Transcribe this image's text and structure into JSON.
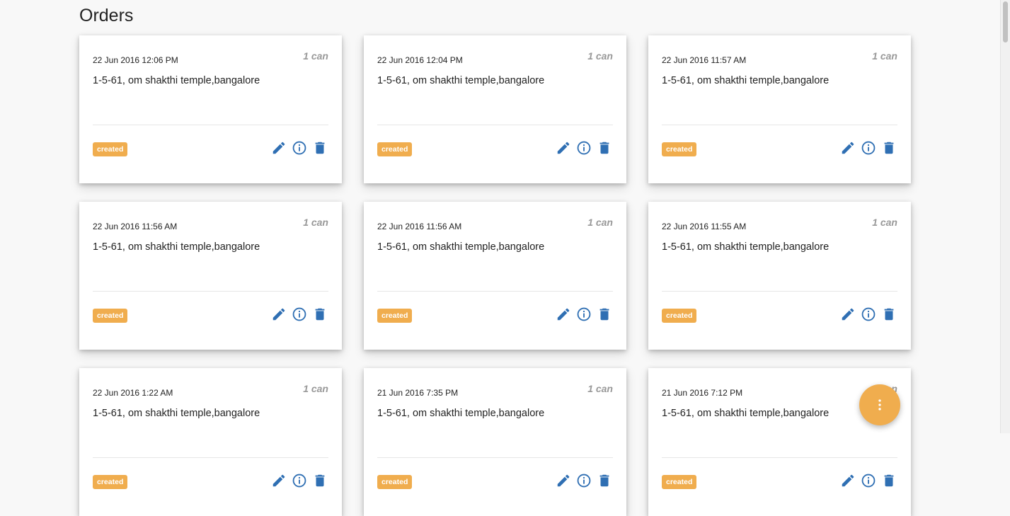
{
  "page": {
    "title": "Orders"
  },
  "colors": {
    "accent": "#f0ad4e",
    "icon": "#2f6fb3"
  },
  "icons": {
    "edit": "pencil-icon",
    "info": "info-icon",
    "delete": "trash-icon",
    "fab": "more-vertical-icon"
  },
  "orders": [
    {
      "date": "22 Jun 2016 12:06 PM",
      "qty": "1 can",
      "address": "1-5-61, om shakthi temple,bangalore",
      "status": "created"
    },
    {
      "date": "22 Jun 2016 12:04 PM",
      "qty": "1 can",
      "address": "1-5-61, om shakthi temple,bangalore",
      "status": "created"
    },
    {
      "date": "22 Jun 2016 11:57 AM",
      "qty": "1 can",
      "address": "1-5-61, om shakthi temple,bangalore",
      "status": "created"
    },
    {
      "date": "22 Jun 2016 11:56 AM",
      "qty": "1 can",
      "address": "1-5-61, om shakthi temple,bangalore",
      "status": "created"
    },
    {
      "date": "22 Jun 2016 11:56 AM",
      "qty": "1 can",
      "address": "1-5-61, om shakthi temple,bangalore",
      "status": "created"
    },
    {
      "date": "22 Jun 2016 11:55 AM",
      "qty": "1 can",
      "address": "1-5-61, om shakthi temple,bangalore",
      "status": "created"
    },
    {
      "date": "22 Jun 2016 1:22 AM",
      "qty": "1 can",
      "address": "1-5-61, om shakthi temple,bangalore",
      "status": "created"
    },
    {
      "date": "21 Jun 2016 7:35 PM",
      "qty": "1 can",
      "address": "1-5-61, om shakthi temple,bangalore",
      "status": "created"
    },
    {
      "date": "21 Jun 2016 7:12 PM",
      "qty": "1 can",
      "address": "1-5-61, om shakthi temple,bangalore",
      "status": "created"
    }
  ]
}
